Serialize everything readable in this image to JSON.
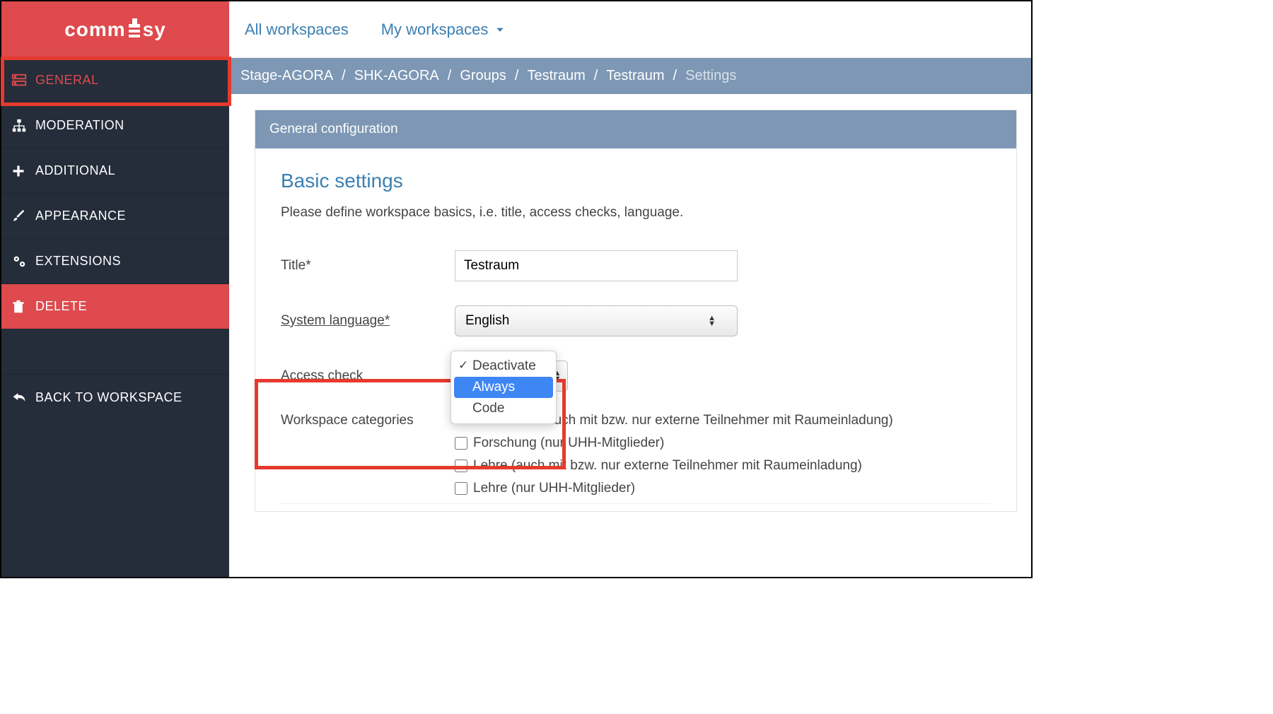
{
  "brand": {
    "name_part1": "comm",
    "name_part2": "sy"
  },
  "sidebar": {
    "items": [
      {
        "label": "GENERAL"
      },
      {
        "label": "MODERATION"
      },
      {
        "label": "ADDITIONAL"
      },
      {
        "label": "APPEARANCE"
      },
      {
        "label": "EXTENSIONS"
      },
      {
        "label": "DELETE"
      }
    ],
    "back_label": "BACK TO WORKSPACE"
  },
  "topbar": {
    "all_label": "All workspaces",
    "my_label": "My workspaces"
  },
  "breadcrumb": {
    "items": [
      "Stage-AGORA",
      "SHK-AGORA",
      "Groups",
      "Testraum",
      "Testraum"
    ],
    "current": "Settings"
  },
  "panel": {
    "header": "General configuration",
    "section_title": "Basic settings",
    "section_desc": "Please define workspace basics, i.e. title, access checks, language."
  },
  "form": {
    "title_label": "Title*",
    "title_value": "Testraum",
    "language_label": "System language*",
    "language_value": "English",
    "access_label": "Access check",
    "access_options": [
      {
        "label": "Deactivate",
        "checked": true,
        "highlight": false
      },
      {
        "label": "Always",
        "checked": false,
        "highlight": true
      },
      {
        "label": "Code",
        "checked": false,
        "highlight": false
      }
    ],
    "categories_label": "Workspace categories",
    "categories": [
      "auch mit bzw. nur externe Teilnehmer mit Raumeinladung)",
      "Forschung (nur UHH-Mitglieder)",
      "Lehre (auch mit bzw. nur externe Teilnehmer mit Raumeinladung)",
      "Lehre (nur UHH-Mitglieder)"
    ]
  }
}
